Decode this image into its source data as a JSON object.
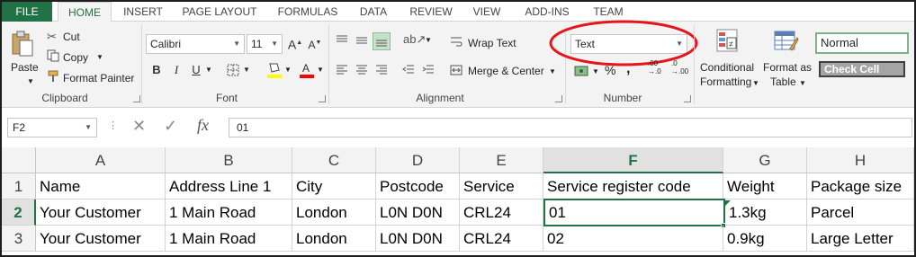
{
  "tabs": [
    "FILE",
    "HOME",
    "INSERT",
    "PAGE LAYOUT",
    "FORMULAS",
    "DATA",
    "REVIEW",
    "VIEW",
    "ADD-INS",
    "TEAM"
  ],
  "clipboard": {
    "paste": "Paste",
    "cut": "Cut",
    "copy": "Copy",
    "format_painter": "Format Painter",
    "label": "Clipboard"
  },
  "font": {
    "name": "Calibri",
    "size": "11",
    "bold": "B",
    "italic": "I",
    "underline": "U",
    "label": "Font"
  },
  "alignment": {
    "wrap_text": "Wrap Text",
    "merge_center": "Merge & Center",
    "label": "Alignment"
  },
  "number": {
    "format": "Text",
    "percent": "%",
    "comma": ",",
    "inc_decimal": ".00 →.0",
    "dec_decimal": ".0 →.00",
    "label": "Number"
  },
  "styles": {
    "conditional_1": "Conditional",
    "conditional_2": "Formatting",
    "format_as_1": "Format as",
    "format_as_2": "Table",
    "normal": "Normal",
    "check_cell": "Check Cell"
  },
  "formula_bar": {
    "name_box": "F2",
    "cancel": "✕",
    "enter": "✓",
    "fx": "fx",
    "value": "01"
  },
  "columns": [
    "A",
    "B",
    "C",
    "D",
    "E",
    "F",
    "G",
    "H"
  ],
  "rows": [
    {
      "num": "1",
      "cells": [
        "Name",
        "Address Line 1",
        "City",
        "Postcode",
        "Service",
        "Service register code",
        "Weight",
        "Package size"
      ]
    },
    {
      "num": "2",
      "cells": [
        "Your Customer",
        "1 Main Road",
        "London",
        "L0N D0N",
        "CRL24",
        "01",
        "1.3kg",
        "Parcel"
      ]
    },
    {
      "num": "3",
      "cells": [
        "Your Customer",
        "1 Main Road",
        "London",
        "L0N D0N",
        "CRL24",
        "02",
        "0.9kg",
        "Large Letter"
      ]
    }
  ],
  "colors": {
    "excel_green": "#217346",
    "highlight_ellipse": "#e3161b",
    "fill_yellow": "#ffff00",
    "font_red": "#ff0000"
  }
}
